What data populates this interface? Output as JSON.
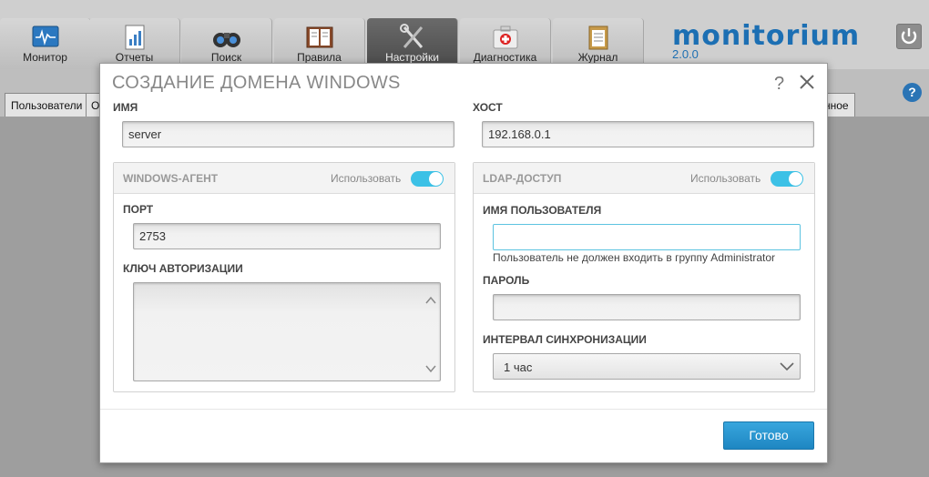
{
  "app": {
    "tabs": [
      {
        "label": "Монитор",
        "icon": "monitor-icon"
      },
      {
        "label": "Отчеты",
        "icon": "reports-icon"
      },
      {
        "label": "Поиск",
        "icon": "binoculars-icon"
      },
      {
        "label": "Правила",
        "icon": "rules-book-icon"
      },
      {
        "label": "Настройки",
        "icon": "tools-icon",
        "active": true
      },
      {
        "label": "Диагностика",
        "icon": "first-aid-icon"
      },
      {
        "label": "Журнал",
        "icon": "clipboard-icon"
      }
    ],
    "logo": "monitorium",
    "version": "2.0.0",
    "subtabs": {
      "users": "Пользователи",
      "partial_left": "О",
      "partial_right": "нное"
    }
  },
  "modal": {
    "title": "СОЗДАНИЕ ДОМЕНА WINDOWS",
    "help": "?",
    "name": {
      "label": "ИМЯ",
      "value": "server"
    },
    "host": {
      "label": "ХОСТ",
      "value": "192.168.0.1"
    },
    "windows_agent": {
      "title": "WINDOWS-АГЕНТ",
      "use_label": "Использовать",
      "enabled": true,
      "port": {
        "label": "ПОРТ",
        "value": "2753"
      },
      "auth_key": {
        "label": "КЛЮЧ АВТОРИЗАЦИИ",
        "value": ""
      }
    },
    "ldap": {
      "title": "LDAP-ДОСТУП",
      "use_label": "Использовать",
      "enabled": true,
      "username": {
        "label": "ИМЯ ПОЛЬЗОВАТЕЛЯ",
        "value": "",
        "hint": "Пользователь не должен входить в группу Administrator"
      },
      "password": {
        "label": "ПАРОЛЬ",
        "value": ""
      },
      "sync_interval": {
        "label": "ИНТЕРВАЛ СИНХРОНИЗАЦИИ",
        "value": "1 час"
      }
    },
    "done_label": "Готово"
  },
  "colors": {
    "accent": "#3cc1e6",
    "button": "#2a92cf",
    "logo": "#1c6fb3"
  }
}
